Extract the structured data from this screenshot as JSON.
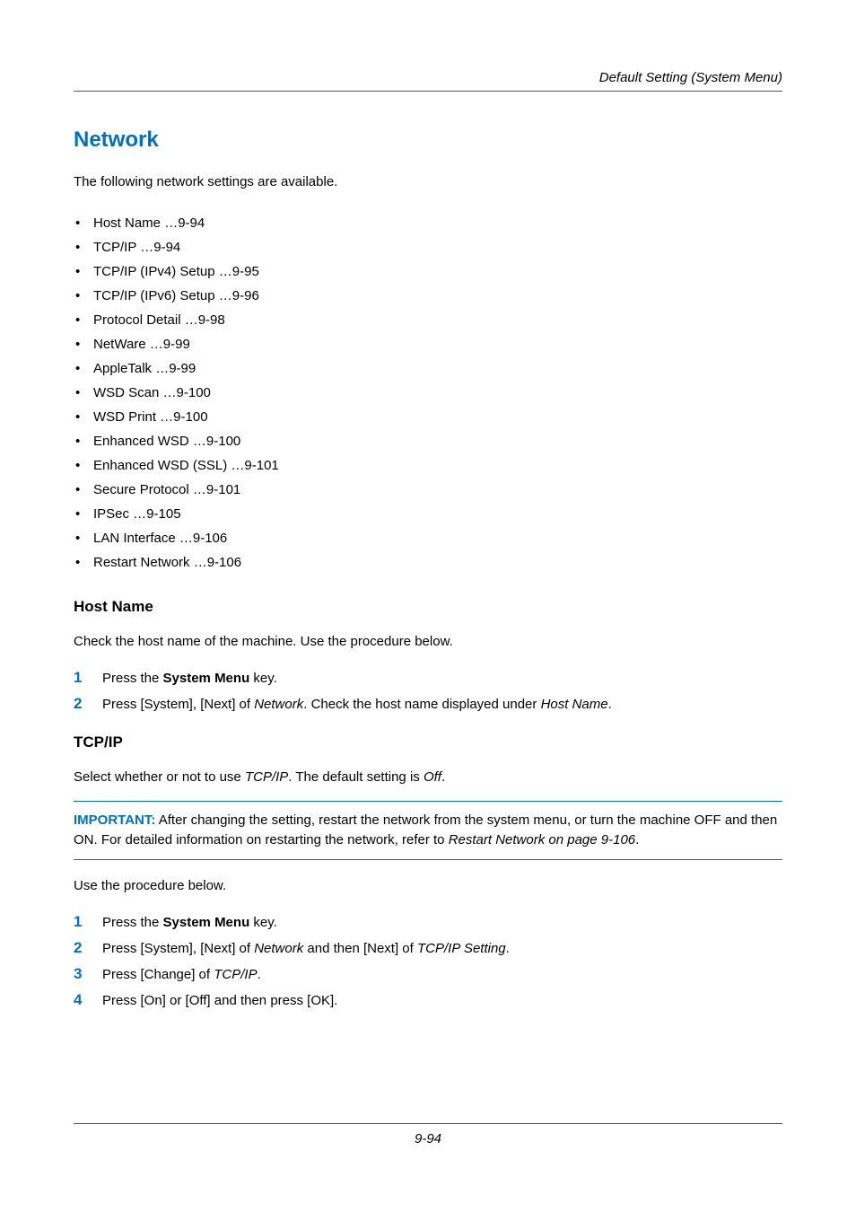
{
  "header": {
    "section": "Default Setting (System Menu)"
  },
  "title": "Network",
  "intro": "The following network settings are available.",
  "bullets": [
    "Host Name …9-94",
    "TCP/IP …9-94",
    "TCP/IP (IPv4) Setup …9-95",
    "TCP/IP (IPv6) Setup …9-96",
    "Protocol Detail …9-98",
    "NetWare …9-99",
    "AppleTalk …9-99",
    "WSD Scan …9-100",
    "WSD Print …9-100",
    "Enhanced WSD …9-100",
    "Enhanced WSD (SSL) …9-101",
    "Secure Protocol …9-101",
    "IPSec …9-105",
    "LAN Interface …9-106",
    "Restart Network …9-106"
  ],
  "hostName": {
    "heading": "Host Name",
    "desc": "Check the host name of the machine. Use the procedure below.",
    "steps": {
      "s1_a": "Press the ",
      "s1_b": "System Menu",
      "s1_c": " key.",
      "s2_a": "Press [System], [Next] of ",
      "s2_b": "Network",
      "s2_c": ". Check the host name displayed under ",
      "s2_d": "Host Name",
      "s2_e": "."
    }
  },
  "tcpip": {
    "heading": "TCP/IP",
    "desc_a": "Select whether or not to use ",
    "desc_b": "TCP/IP",
    "desc_c": ". The default setting is ",
    "desc_d": "Off",
    "desc_e": ".",
    "note_label": "IMPORTANT:",
    "note_a": " After changing the setting, restart the network from the system menu, or turn the machine OFF and then ON. For detailed information on restarting the network, refer to ",
    "note_b": "Restart Network on page 9-106",
    "note_c": ".",
    "use": "Use the procedure below.",
    "steps": {
      "s1_a": "Press the ",
      "s1_b": "System Menu",
      "s1_c": " key.",
      "s2_a": "Press [System], [Next] of ",
      "s2_b": "Network",
      "s2_c": " and then [Next] of ",
      "s2_d": "TCP/IP Setting",
      "s2_e": ".",
      "s3_a": "Press [Change] of ",
      "s3_b": "TCP/IP",
      "s3_c": ".",
      "s4": "Press [On] or [Off] and then press [OK]."
    }
  },
  "footer": {
    "pageNum": "9-94"
  },
  "nums": {
    "n1": "1",
    "n2": "2",
    "n3": "3",
    "n4": "4"
  }
}
